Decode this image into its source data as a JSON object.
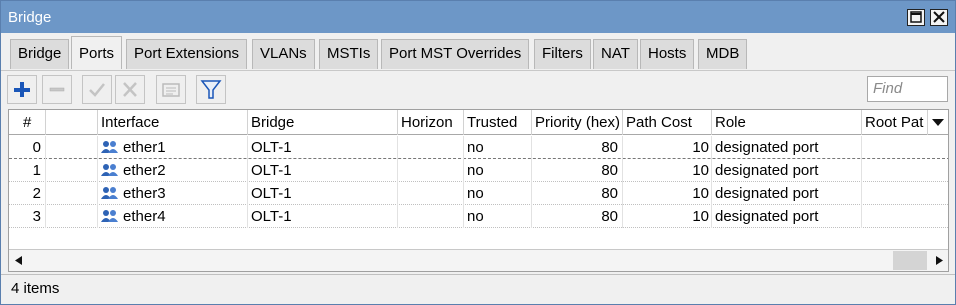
{
  "window": {
    "title": "Bridge"
  },
  "tabs": [
    {
      "label": "Bridge"
    },
    {
      "label": "Ports"
    },
    {
      "label": "Port Extensions"
    },
    {
      "label": "VLANs"
    },
    {
      "label": "MSTIs"
    },
    {
      "label": "Port MST Overrides"
    },
    {
      "label": "Filters"
    },
    {
      "label": "NAT"
    },
    {
      "label": "Hosts"
    },
    {
      "label": "MDB"
    }
  ],
  "active_tab": "Ports",
  "toolbar": {
    "icons": [
      "plus-icon",
      "minus-icon",
      "check-icon",
      "x-icon",
      "comment-icon",
      "filter-icon"
    ],
    "find_placeholder": "Find"
  },
  "table": {
    "columns": [
      "#",
      "",
      "Interface",
      "Bridge",
      "Horizon",
      "Trusted",
      "Priority (hex)",
      "Path Cost",
      "Role",
      "Root Pat"
    ],
    "rows": [
      {
        "num": "0",
        "interface": "ether1",
        "bridge": "OLT-1",
        "horizon": "",
        "trusted": "no",
        "priority": "80",
        "path_cost": "10",
        "role": "designated port",
        "root_path": ""
      },
      {
        "num": "1",
        "interface": "ether2",
        "bridge": "OLT-1",
        "horizon": "",
        "trusted": "no",
        "priority": "80",
        "path_cost": "10",
        "role": "designated port",
        "root_path": ""
      },
      {
        "num": "2",
        "interface": "ether3",
        "bridge": "OLT-1",
        "horizon": "",
        "trusted": "no",
        "priority": "80",
        "path_cost": "10",
        "role": "designated port",
        "root_path": ""
      },
      {
        "num": "3",
        "interface": "ether4",
        "bridge": "OLT-1",
        "horizon": "",
        "trusted": "no",
        "priority": "80",
        "path_cost": "10",
        "role": "designated port",
        "root_path": ""
      }
    ]
  },
  "status": {
    "text": "4 items"
  },
  "colors": {
    "titlebar": "#6d97c7",
    "accent_blue": "#1a56b8"
  }
}
